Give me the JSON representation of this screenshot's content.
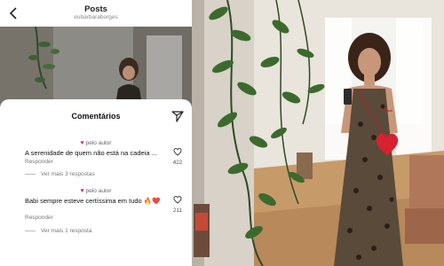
{
  "header": {
    "title": "Posts",
    "username": "eubarbaraborges",
    "back_icon": "chevron-left-icon"
  },
  "comments_sheet": {
    "title": "Comentários",
    "share_icon": "send-icon",
    "comments": [
      {
        "author_tag": "pelo autor",
        "text": "A serenidade de quem não está na cadeia ...",
        "reply_label": "Responder",
        "likes": "422",
        "more_replies": "Ver mais 3 respostas"
      },
      {
        "author_tag": "pelo autor",
        "text": "Babi sempre esteve certíssima em tudo 🔥❤️",
        "reply_label": "Responder",
        "likes": "211",
        "more_replies": "Ver mais 1 resposta"
      }
    ]
  },
  "colors": {
    "heart": "#e0245e",
    "sheet_bg": "#ffffff",
    "text_primary": "#111111",
    "text_secondary": "#777777"
  }
}
